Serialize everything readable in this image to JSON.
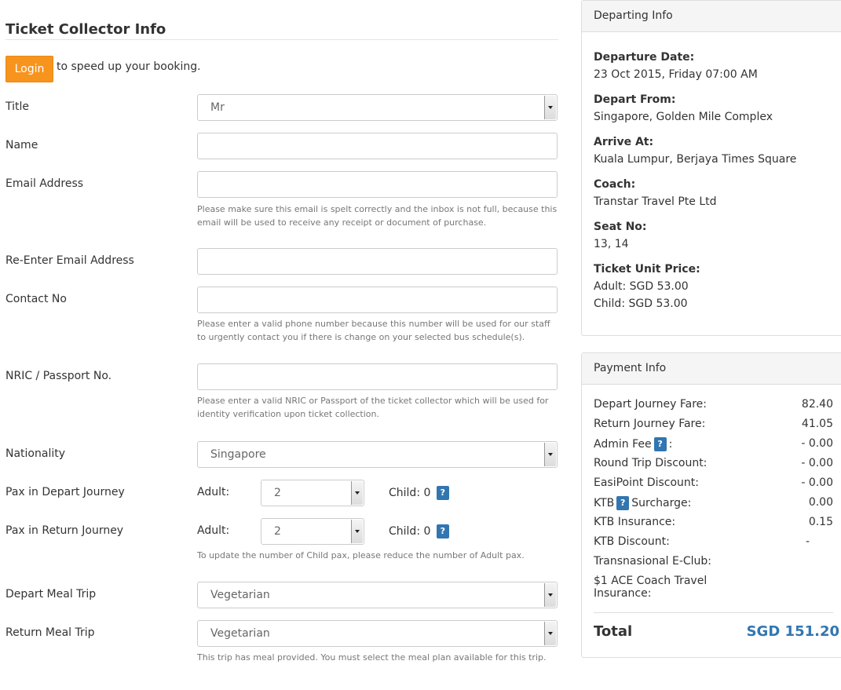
{
  "form": {
    "title": "Ticket Collector Info",
    "login_label": "Login",
    "login_text": "to speed up your booking.",
    "fields": {
      "title_label": "Title",
      "title_value": "Mr",
      "name_label": "Name",
      "name_value": "",
      "email_label": "Email Address",
      "email_value": "",
      "email_help": "Please make sure this email is spelt correctly and the inbox is not full, because this email will be used to receive any receipt or document of purchase.",
      "reemail_label": "Re-Enter Email Address",
      "reemail_value": "",
      "contact_label": "Contact No",
      "contact_value": "",
      "contact_help": "Please enter a valid phone number because this number will be used for our staff to urgently contact you if there is change on your selected bus schedule(s).",
      "nric_label": "NRIC / Passport No.",
      "nric_value": "",
      "nric_help": "Please enter a valid NRIC or Passport of the ticket collector which will be used for identity verification upon ticket collection.",
      "nationality_label": "Nationality",
      "nationality_value": "Singapore",
      "pax_depart_label": "Pax in Depart Journey",
      "pax_return_label": "Pax in Return Journey",
      "adult_label": "Adult:",
      "adult_depart_value": "2",
      "adult_return_value": "2",
      "child_depart_label": "Child: 0",
      "child_return_label": "Child: 0",
      "help_badge": "?",
      "pax_help": "To update the number of Child pax, please reduce the number of Adult pax.",
      "depart_meal_label": "Depart Meal Trip",
      "depart_meal_value": "Vegetarian",
      "return_meal_label": "Return Meal Trip",
      "return_meal_value": "Vegetarian",
      "meal_help": "This trip has meal provided. You must select the meal plan available for this trip."
    }
  },
  "departing": {
    "heading": "Departing Info",
    "departure_date_label": "Departure Date:",
    "departure_date": "23 Oct 2015, Friday 07:00 AM",
    "depart_from_label": "Depart From:",
    "depart_from": "Singapore, Golden Mile Complex",
    "arrive_at_label": "Arrive At:",
    "arrive_at": "Kuala Lumpur, Berjaya Times Square",
    "coach_label": "Coach:",
    "coach": "Transtar Travel Pte Ltd",
    "seat_label": "Seat No:",
    "seat": "13, 14",
    "unit_price_label": "Ticket Unit Price:",
    "adult_price": "Adult: SGD 53.00",
    "child_price": "Child: SGD 53.00"
  },
  "payment": {
    "heading": "Payment Info",
    "rows": [
      {
        "label": "Depart Journey Fare:",
        "amount": "82.40"
      },
      {
        "label": "Return Journey Fare:",
        "amount": "41.05"
      },
      {
        "label": "Admin Fee",
        "suffix": ":",
        "amount": "- 0.00"
      },
      {
        "label": "Round Trip Discount:",
        "amount": "- 0.00"
      },
      {
        "label": "EasiPoint Discount:",
        "amount": "- 0.00"
      },
      {
        "label": "KTB",
        "suffix": "Surcharge:",
        "amount": "0.00"
      },
      {
        "label": "KTB Insurance:",
        "amount": "0.15"
      },
      {
        "label": "KTB Discount:",
        "amount": "-"
      },
      {
        "label": "Transnasional E-Club:",
        "amount": ""
      },
      {
        "label": "$1 ACE Coach Travel",
        "label2": "Insurance:",
        "amount": ""
      }
    ],
    "total_label": "Total",
    "total_amount": "SGD 151.20"
  },
  "colors": {
    "login_button": "#f7941d",
    "help_badge": "#3276b1",
    "total_amount": "#3276b1"
  }
}
